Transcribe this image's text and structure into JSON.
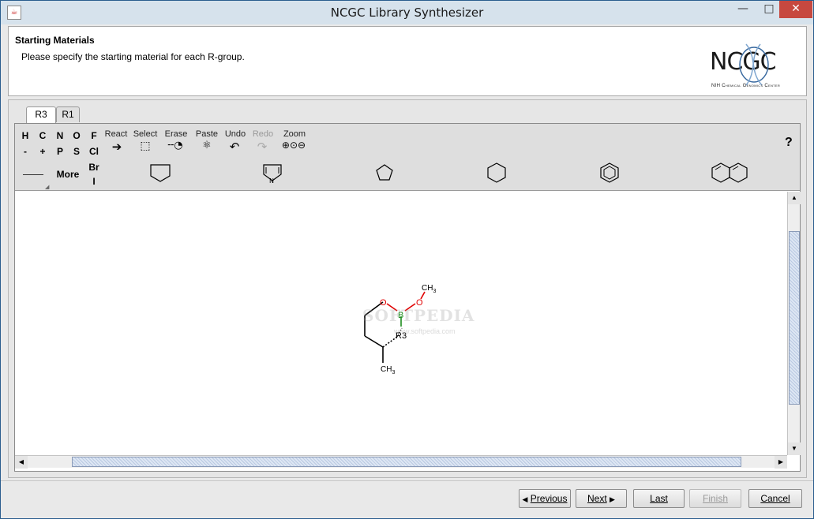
{
  "window": {
    "title": "NCGC Library Synthesizer",
    "minimize_glyph": "—",
    "maximize_glyph": "□",
    "close_glyph": "✕"
  },
  "header": {
    "title": "Starting Materials",
    "subtitle": "Please specify the starting material for each R-group.",
    "logo_text": "NCGC",
    "logo_caption": "NIH Chemical Genomics Center"
  },
  "tabs": [
    {
      "label": "R3",
      "active": true
    },
    {
      "label": "R1",
      "active": false
    }
  ],
  "toolbar": {
    "elements_row1": [
      "H",
      "C",
      "N",
      "O",
      "F"
    ],
    "elements_row2": [
      "-",
      "+",
      "P",
      "S",
      "Cl"
    ],
    "element_br": "Br",
    "element_i": "I",
    "more_label": "More",
    "react_label": "React",
    "select_label": "Select",
    "erase_label": "Erase",
    "paste_label": "Paste",
    "undo_label": "Undo",
    "redo_label": "Redo",
    "zoom_label": "Zoom",
    "help_label": "?",
    "templates": [
      "cyclopentane-template-icon",
      "pyrrole-template-icon",
      "cyclopentane-small-template-icon",
      "cyclohexane-template-icon",
      "benzene-template-icon",
      "naphthalene-template-icon"
    ]
  },
  "molecule": {
    "labels": {
      "ch3_top": "CH",
      "ch3_top_sub": "3",
      "o_left": "O",
      "o_right": "O",
      "boron": "B",
      "r3": "R3",
      "ch3_bottom": "CH",
      "ch3_bottom_sub": "3"
    }
  },
  "watermark": {
    "text": "SOFTPEDIA",
    "sub": "www.softpedia.com"
  },
  "buttons": {
    "previous": "Previous",
    "next": "Next",
    "last": "Last",
    "finish": "Finish",
    "cancel": "Cancel"
  },
  "colors": {
    "oxygen": "#e00000",
    "boron": "#1e8c1e",
    "titlebar": "#d6e2ec",
    "close": "#c7483f"
  }
}
